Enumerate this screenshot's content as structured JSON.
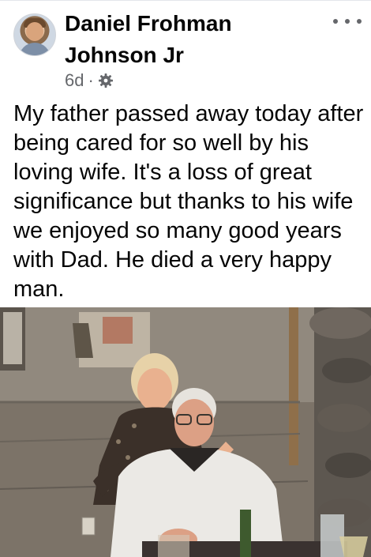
{
  "post": {
    "author_line1": "Daniel Frohman",
    "author_line2": "Johnson Jr",
    "time": "6d",
    "separator": "·",
    "audience_icon": "gear-icon",
    "text": "My father passed away today after being cared for so well by his loving wife. It's a loss of great significance but thanks to his wife we enjoyed so many good years with Dad. He died a very happy man."
  },
  "icons": {
    "more": "more-horizontal-icon"
  },
  "colors": {
    "text_primary": "#050505",
    "text_secondary": "#65676b"
  }
}
